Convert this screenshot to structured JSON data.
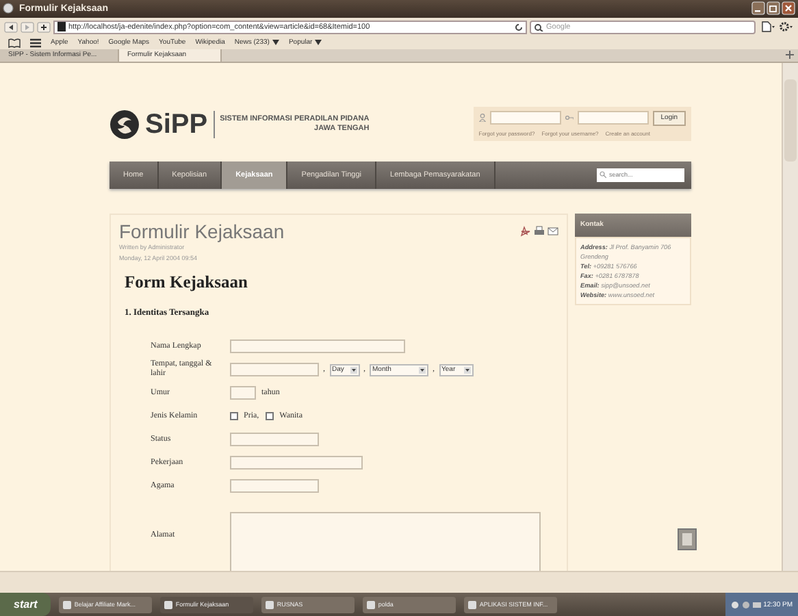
{
  "window": {
    "title": "Formulir Kejaksaan"
  },
  "toolbar": {
    "address": "http://localhost/ja-edenite/index.php?option=com_content&view=article&id=68&Itemid=100",
    "search_placeholder": "Google"
  },
  "bookmarks": [
    {
      "label": "Apple",
      "menu": false
    },
    {
      "label": "Yahoo!",
      "menu": false
    },
    {
      "label": "Google Maps",
      "menu": false
    },
    {
      "label": "YouTube",
      "menu": false
    },
    {
      "label": "Wikipedia",
      "menu": false
    },
    {
      "label": "News (233)",
      "menu": true
    },
    {
      "label": "Popular",
      "menu": true
    }
  ],
  "browser_tabs": [
    {
      "label": "SIPP - Sistem Informasi Pe...",
      "selected": false
    },
    {
      "label": "Formulir Kejaksaan",
      "selected": true
    }
  ],
  "site": {
    "logo": "SiPP",
    "tagline": [
      "SISTEM INFORMASI PERADILAN PIDANA",
      "JAWA TENGAH"
    ],
    "login": {
      "button": "Login",
      "links": [
        "Forgot your password?",
        "Forgot your username?",
        "Create an account"
      ]
    },
    "nav": [
      {
        "label": "Home",
        "selected": false
      },
      {
        "label": "Kepolisian",
        "selected": false
      },
      {
        "label": "Kejaksaan",
        "selected": true
      },
      {
        "label": "Pengadilan Tinggi",
        "selected": false
      },
      {
        "label": "Lembaga Pemasyarakatan",
        "selected": false
      }
    ],
    "search_placeholder": "search..."
  },
  "article": {
    "title": "Formulir Kejaksaan",
    "author": "Written by Administrator",
    "date": "Monday, 12 April 2004 09:54",
    "heading": "Form Kejaksaan",
    "section": "1. Identitas Tersangka",
    "fields": [
      {
        "kind": "long",
        "label": "Nama Lengkap"
      },
      {
        "kind": "birth",
        "label": "Tempat, tanggal & lahir",
        "selects": [
          {
            "separator": ",",
            "label": "Day"
          },
          {
            "separator": ",",
            "label": "Month"
          },
          {
            "separator": ",",
            "label": "Year"
          }
        ]
      },
      {
        "kind": "number",
        "label": "Umur",
        "unit": "tahun"
      },
      {
        "kind": "checks",
        "label": "Jenis Kelamin",
        "options": [
          {
            "label": "Pria,",
            "checked": false
          },
          {
            "label": "Wanita",
            "checked": false
          }
        ]
      },
      {
        "kind": "short",
        "label": "Status"
      },
      {
        "kind": "medium",
        "label": "Pekerjaan"
      },
      {
        "kind": "short",
        "label": "Agama"
      },
      {
        "kind": "area",
        "label": "Alamat"
      }
    ]
  },
  "sidebar": {
    "title": "Kontak",
    "lines": [
      "**Address:** Jl Prof. Banyamin 706 Grendeng",
      "**Tel:** +09281 576766",
      "**Fax:** +0281 6787878",
      "**Email:** sipp@unsoed.net",
      "**Website:** www.unsoed.net"
    ]
  },
  "taskbar": {
    "start": "start",
    "items": [
      "Belajar Affiliate Mark...",
      "Formulir Kejaksaan",
      "RUSNAS",
      "polda",
      "APLIKASI SISTEM INF..."
    ],
    "clock": "12:30 PM"
  }
}
